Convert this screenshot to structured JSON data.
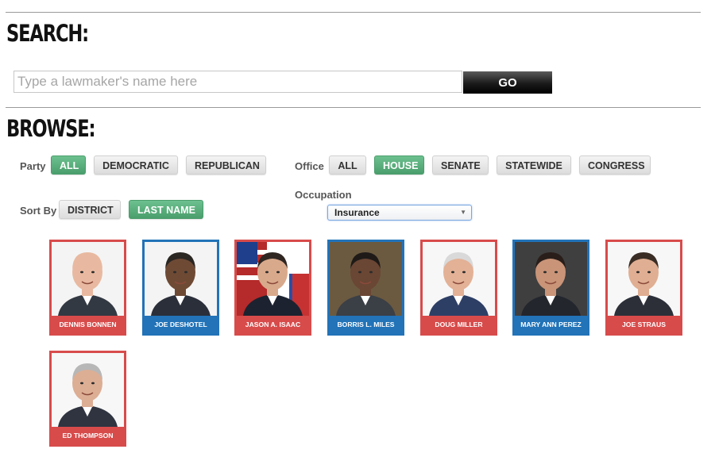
{
  "search": {
    "title": "SEARCH:",
    "placeholder": "Type a lawmaker's name here",
    "go_label": "GO"
  },
  "browse": {
    "title": "BROWSE:",
    "party": {
      "label": "Party",
      "options": [
        "ALL",
        "DEMOCRATIC",
        "REPUBLICAN"
      ],
      "selected": "ALL"
    },
    "office": {
      "label": "Office",
      "options": [
        "ALL",
        "HOUSE",
        "SENATE",
        "STATEWIDE",
        "CONGRESS"
      ],
      "selected": "HOUSE"
    },
    "sort": {
      "label": "Sort By",
      "options": [
        "DISTRICT",
        "LAST NAME"
      ],
      "selected": "LAST NAME"
    },
    "occupation": {
      "label": "Occupation",
      "selected": "Insurance"
    }
  },
  "lawmakers": [
    {
      "name": "DENNIS BONNEN",
      "party": "R"
    },
    {
      "name": "JOE DESHOTEL",
      "party": "D"
    },
    {
      "name": "JASON A. ISAAC",
      "party": "R"
    },
    {
      "name": "BORRIS L. MILES",
      "party": "D"
    },
    {
      "name": "DOUG MILLER",
      "party": "R"
    },
    {
      "name": "MARY ANN PEREZ",
      "party": "D"
    },
    {
      "name": "JOE STRAUS",
      "party": "R"
    },
    {
      "name": "ED THOMPSON",
      "party": "R"
    }
  ],
  "colors": {
    "republican": "#d84b4b",
    "democrat": "#2273b8",
    "active_pill": "#5aae7c"
  }
}
